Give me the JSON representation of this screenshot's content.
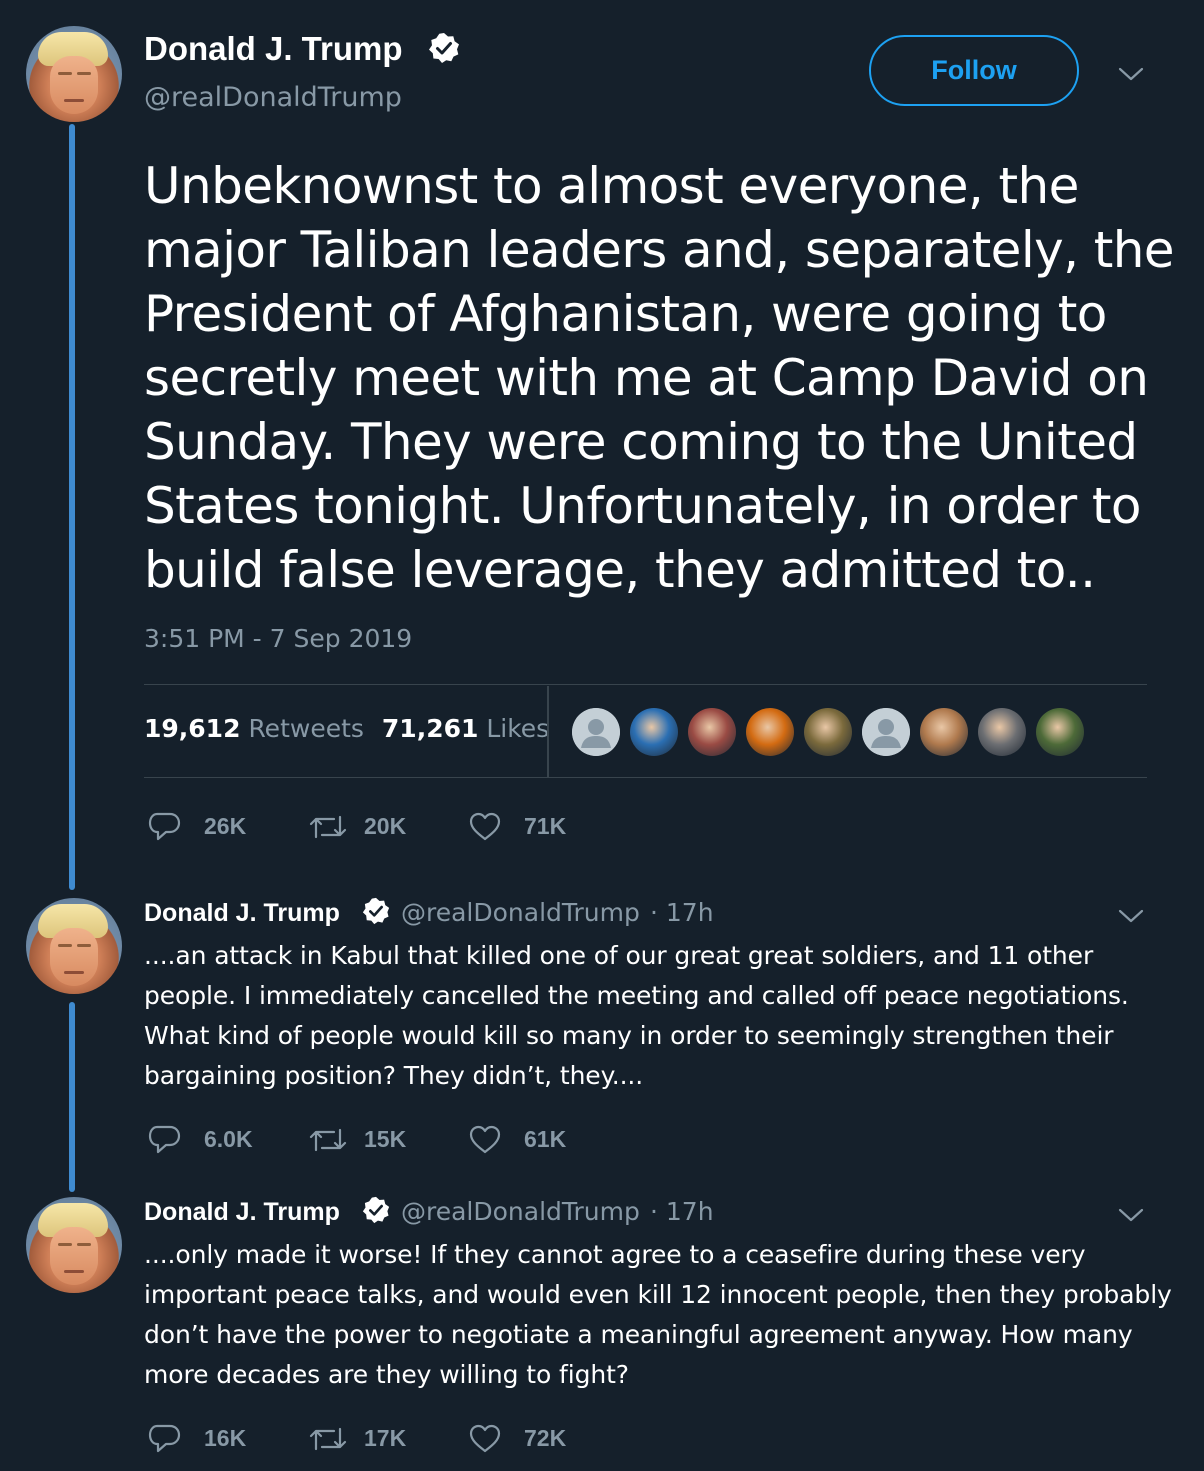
{
  "main_tweet": {
    "author_name": "Donald J. Trump",
    "author_handle": "@realDonaldTrump",
    "follow_label": "Follow",
    "text": "Unbeknownst to almost everyone, the major Taliban leaders and, separately, the President of Afghanistan, were going to secretly meet with me at Camp David on Sunday. They were coming to the United States tonight. Unfortunately, in order to build false leverage, they admitted to..",
    "timestamp": "3:51 PM - 7 Sep 2019",
    "retweets_count": "19,612",
    "retweets_label": "Retweets",
    "likes_count": "71,261",
    "likes_label": "Likes",
    "actions": {
      "reply_count": "26K",
      "retweet_count": "20K",
      "like_count": "71K"
    },
    "likers": [
      {
        "icon": "default-avatar",
        "color": "#8899a6"
      },
      {
        "icon": "user-photo",
        "color": "#2b6fb3"
      },
      {
        "icon": "user-photo",
        "color": "#9a4b44"
      },
      {
        "icon": "user-photo",
        "color": "#d36b12"
      },
      {
        "icon": "user-photo",
        "color": "#7b6a3c"
      },
      {
        "icon": "default-avatar",
        "color": "#8899a6"
      },
      {
        "icon": "user-photo",
        "color": "#b07a4e"
      },
      {
        "icon": "user-photo",
        "color": "#6c6e72"
      },
      {
        "icon": "user-photo",
        "color": "#4d6a38"
      }
    ]
  },
  "replies": [
    {
      "author_name": "Donald J. Trump",
      "author_handle": "@realDonaldTrump",
      "time": "· 17h",
      "text": "....an attack in Kabul that killed one of our great great soldiers, and 11 other people. I immediately cancelled the meeting and called off peace negotiations. What kind of people would kill so many in order to seemingly strengthen their bargaining position? They didn’t, they....",
      "reply_count": "6.0K",
      "retweet_count": "15K",
      "like_count": "61K"
    },
    {
      "author_name": "Donald J. Trump",
      "author_handle": "@realDonaldTrump",
      "time": "· 17h",
      "text": "....only made it worse! If they cannot agree to a ceasefire during these very important peace talks, and would even kill 12 innocent people, then they probably don’t have the power to negotiate a meaningful agreement anyway. How many more decades are they willing to fight?",
      "reply_count": "16K",
      "retweet_count": "17K",
      "like_count": "72K"
    }
  ],
  "colors": {
    "background": "#15202b",
    "accent": "#1da1f2",
    "thread_line": "#3f8bd0",
    "secondary_text": "#8899a6",
    "divider": "#38444d"
  }
}
